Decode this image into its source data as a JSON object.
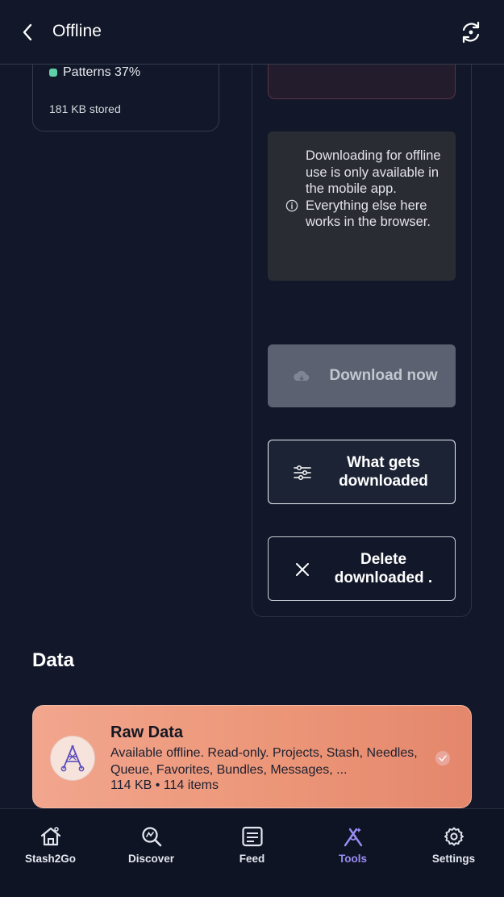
{
  "header": {
    "title": "Offline",
    "back_icon": "chevron-left-icon",
    "sync_icon": "sync-icon"
  },
  "storage_card": {
    "legend": [
      {
        "label": "Patterns 37%",
        "color": "#5fd0a8"
      }
    ],
    "stored": "181 KB stored"
  },
  "notice": {
    "text": "Downloading for offline use is only available in the mobile app. Everything else here works in the browser.",
    "icon": "info-icon"
  },
  "actions": {
    "download_label": "Download now",
    "what_label": "What gets downloaded",
    "delete_label": "Delete downloaded ."
  },
  "data_section": {
    "title": "Data",
    "raw": {
      "title": "Raw Data",
      "description": "Available offline. Read-only. Projects, Stash, Needles, Queue, Favorites, Bundles, Messages, ...",
      "meta": "114 KB • 114 items",
      "gradient_start": "#f2a68e",
      "gradient_end": "#e4876c"
    }
  },
  "bottom_nav": {
    "items": [
      {
        "label": "Stash2Go",
        "icon": "home-icon"
      },
      {
        "label": "Discover",
        "icon": "search-icon"
      },
      {
        "label": "Feed",
        "icon": "feed-icon"
      },
      {
        "label": "Tools",
        "icon": "tools-icon",
        "active": true
      },
      {
        "label": "Settings",
        "icon": "gear-icon"
      }
    ],
    "active_color": "#9a8cf2"
  }
}
